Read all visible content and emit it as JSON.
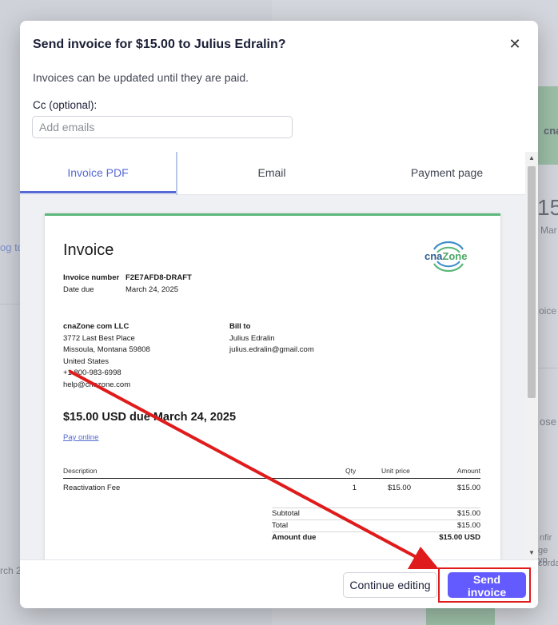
{
  "background": {
    "fragments": [
      "cna",
      "15",
      "Mar",
      "og to",
      "oice",
      "ose",
      "nfir",
      "ge yo",
      "corda",
      "rch 2"
    ]
  },
  "modal": {
    "title": "Send invoice for $15.00 to Julius Edralin?",
    "subtitle": "Invoices can be updated until they are paid.",
    "cc": {
      "label": "Cc (optional):",
      "placeholder": "Add emails",
      "value": ""
    },
    "tabs": [
      {
        "label": "Invoice PDF",
        "active": true
      },
      {
        "label": "Email",
        "active": false
      },
      {
        "label": "Payment page",
        "active": false
      }
    ],
    "footer": {
      "continue_label": "Continue editing",
      "send_label": "Send invoice"
    }
  },
  "invoice": {
    "title": "Invoice",
    "logo_text_1": "cna",
    "logo_text_2": "Zone",
    "number_label": "Invoice number",
    "number_value": "F2E7AFD8-DRAFT",
    "date_label": "Date due",
    "date_value": "March 24, 2025",
    "from": {
      "name": "cnaZone com LLC",
      "lines": [
        "3772 Last Best Place",
        "Missoula, Montana 59808",
        "United States",
        "+1 800-983-6998",
        "help@cnazone.com"
      ]
    },
    "bill_to": {
      "label": "Bill to",
      "lines": [
        "Julius Edralin",
        "julius.edralin@gmail.com"
      ]
    },
    "due_heading": "$15.00 USD due March 24, 2025",
    "pay_link": "Pay online",
    "table": {
      "headers": {
        "description": "Description",
        "qty": "Qty",
        "unit_price": "Unit price",
        "amount": "Amount"
      },
      "rows": [
        {
          "description": "Reactivation Fee",
          "qty": "1",
          "unit_price": "$15.00",
          "amount": "$15.00"
        }
      ]
    },
    "summary": [
      {
        "label": "Subtotal",
        "value": "$15.00",
        "bold": false
      },
      {
        "label": "Total",
        "value": "$15.00",
        "bold": false
      },
      {
        "label": "Amount due",
        "value": "$15.00 USD",
        "bold": true
      }
    ]
  },
  "colors": {
    "accent": "#635bff",
    "tab_active": "#5469d4",
    "invoice_top": "#5cb87a",
    "annotation": "#e01b1b"
  }
}
